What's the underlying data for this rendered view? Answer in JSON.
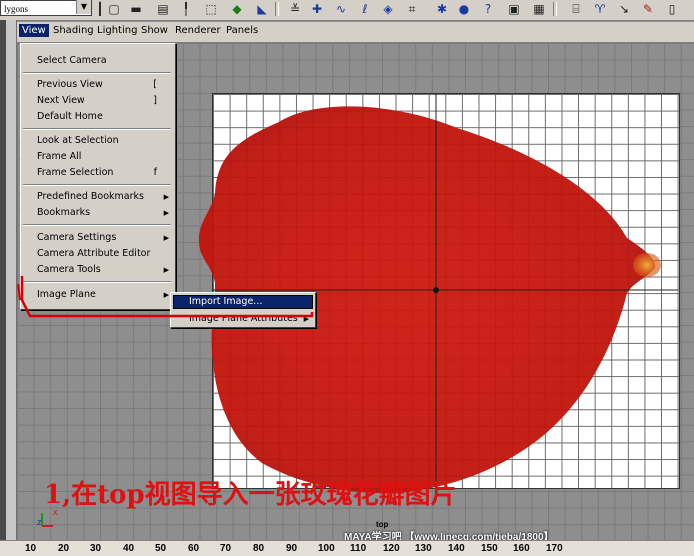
{
  "toolbar": {
    "mode_select": "lygons"
  },
  "panel_menus": [
    "View",
    "Shading",
    "Lighting",
    "Show",
    "Renderer",
    "Panels"
  ],
  "view_menu": {
    "select_camera": "Select Camera",
    "previous_view": "Previous View",
    "previous_view_key": "[",
    "next_view": "Next View",
    "next_view_key": "]",
    "default_home": "Default Home",
    "look_at_selection": "Look at Selection",
    "frame_all": "Frame All",
    "frame_selection": "Frame Selection",
    "frame_selection_key": "f",
    "predefined_bookmarks": "Predefined Bookmarks",
    "bookmarks": "Bookmarks",
    "camera_settings": "Camera Settings",
    "camera_attribute_editor": "Camera Attribute Editor",
    "camera_tools": "Camera Tools",
    "image_plane": "Image Plane"
  },
  "image_plane_submenu": {
    "import_image": "Import Image...",
    "image_plane_attributes": "Image Plane Attributes"
  },
  "viewport": {
    "camera_label": "top",
    "axis_x": "x",
    "axis_z": "z"
  },
  "caption": "1,在top视图导入一张玫瑰花瓣图片",
  "watermark": "MAYA学习吧 【www.linecg.com/tieba/1800】",
  "ruler_ticks": [
    "10",
    "20",
    "30",
    "40",
    "50",
    "60",
    "70",
    "80",
    "90",
    "100",
    "110",
    "120",
    "130",
    "140",
    "150",
    "160",
    "170"
  ],
  "colors": {
    "petal": "#c8180e",
    "menu_highlight": "#0a246a",
    "caption": "#e01010",
    "annotation_line": "#d80000"
  }
}
